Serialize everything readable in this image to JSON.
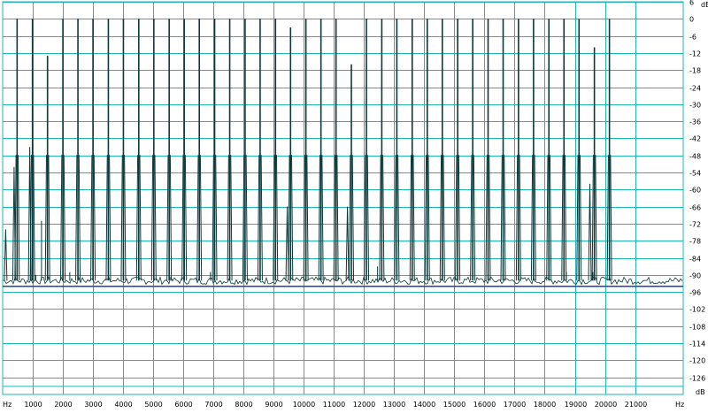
{
  "chart_data": {
    "type": "line",
    "title": "",
    "xlabel": "",
    "ylabel": "",
    "x_unit": "Hz",
    "y_unit": "dB",
    "xlim": [
      0,
      22600
    ],
    "ylim": [
      -132,
      6
    ],
    "grid": true,
    "x_ticks": [
      1000,
      2000,
      3000,
      4000,
      5000,
      6000,
      7000,
      8000,
      9000,
      10000,
      11000,
      12000,
      13000,
      14000,
      15000,
      16000,
      17000,
      18000,
      19000,
      20000,
      21000
    ],
    "y_ticks": [
      6,
      0,
      -6,
      -12,
      -18,
      -24,
      -30,
      -36,
      -42,
      -48,
      -54,
      -60,
      -66,
      -72,
      -78,
      -84,
      -90,
      -96,
      -102,
      -108,
      -114,
      -120,
      -126
    ],
    "noise_floor_db": -92,
    "colors": {
      "grid": "#1fb6b6",
      "baseline": "#1f3fb6",
      "trace": "#0c3a3a",
      "axis_text": "#000000"
    },
    "series": [
      {
        "peaks": [
          {
            "x": 480,
            "y": 0
          },
          {
            "x": 990,
            "y": 0
          },
          {
            "x": 1490,
            "y": -13
          },
          {
            "x": 2000,
            "y": 0
          },
          {
            "x": 2500,
            "y": 0
          },
          {
            "x": 3000,
            "y": 0
          },
          {
            "x": 3510,
            "y": 0
          },
          {
            "x": 4010,
            "y": 0
          },
          {
            "x": 4520,
            "y": 0
          },
          {
            "x": 5020,
            "y": 0
          },
          {
            "x": 5530,
            "y": 0
          },
          {
            "x": 6030,
            "y": 0
          },
          {
            "x": 6530,
            "y": 0
          },
          {
            "x": 7040,
            "y": 0
          },
          {
            "x": 7540,
            "y": 0
          },
          {
            "x": 8050,
            "y": 0
          },
          {
            "x": 8550,
            "y": 0
          },
          {
            "x": 9060,
            "y": 0
          },
          {
            "x": 9560,
            "y": -3
          },
          {
            "x": 10070,
            "y": 0
          },
          {
            "x": 10570,
            "y": 0
          },
          {
            "x": 11070,
            "y": 0
          },
          {
            "x": 11580,
            "y": -16
          },
          {
            "x": 12080,
            "y": 0
          },
          {
            "x": 12590,
            "y": 0
          },
          {
            "x": 13090,
            "y": 0
          },
          {
            "x": 13600,
            "y": 0
          },
          {
            "x": 14100,
            "y": 0
          },
          {
            "x": 14600,
            "y": 0
          },
          {
            "x": 15110,
            "y": 0
          },
          {
            "x": 15610,
            "y": 0
          },
          {
            "x": 16120,
            "y": 0
          },
          {
            "x": 16620,
            "y": 0
          },
          {
            "x": 17130,
            "y": 0
          },
          {
            "x": 17630,
            "y": 0
          },
          {
            "x": 18140,
            "y": 0
          },
          {
            "x": 18640,
            "y": 0
          },
          {
            "x": 19140,
            "y": 0
          },
          {
            "x": 19650,
            "y": -10
          },
          {
            "x": 20150,
            "y": 0
          }
        ],
        "shoulder_db": -48,
        "minor_spurs": [
          {
            "x": 1290,
            "y": -71
          },
          {
            "x": 1100,
            "y": -90
          },
          {
            "x": 2230,
            "y": -89
          },
          {
            "x": 6900,
            "y": -89
          },
          {
            "x": 12450,
            "y": -87
          },
          {
            "x": 18720,
            "y": -89
          },
          {
            "x": 19600,
            "y": -89
          }
        ],
        "side_lobes": [
          {
            "x": 380,
            "y": -52
          },
          {
            "x": 900,
            "y": -45
          },
          {
            "x": 9450,
            "y": -66
          },
          {
            "x": 11450,
            "y": -66
          },
          {
            "x": 19500,
            "y": -58
          },
          {
            "x": 100,
            "y": -74
          }
        ]
      }
    ]
  }
}
